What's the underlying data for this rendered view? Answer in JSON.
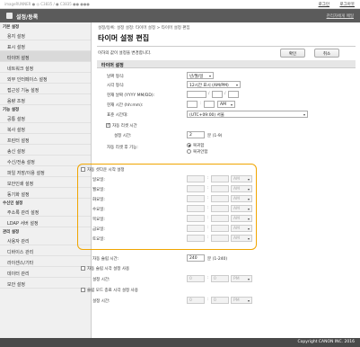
{
  "topbar": {
    "device": "imageRUNNER ● ◎ C3835 / ● C3835 ●● ●●●",
    "links": [
      "로그인",
      "로그아웃"
    ]
  },
  "titlebar": {
    "title": "설정/등록",
    "admin_link": "관리자에게 메일"
  },
  "sidebar": {
    "sections": [
      {
        "header": "기본 설정",
        "items": [
          "용지 설정",
          "표시 설정",
          "타이머 설정",
          "네트워크 설정",
          "외부 인터페이스 설정",
          "접근성 기능 설정",
          "음량 조정"
        ]
      },
      {
        "header": "기능 설정",
        "items": [
          "공통 설정",
          "복사 설정",
          "프린터 설정",
          "송신 설정",
          "수신/전송 설정",
          "파일 저장/이용 설정",
          "보안인쇄 설정",
          "동기화 설정"
        ]
      },
      {
        "header": "수신인 설정",
        "items": [
          "주소록 관리 설정",
          "LDAP 서버 설정"
        ]
      },
      {
        "header": "관리 설정",
        "items": [
          "사용자 관리",
          "디바이스 관리",
          "라이센스/기타",
          "데이터 관리",
          "보안 설정"
        ]
      }
    ],
    "active_item": "타이머 설정"
  },
  "content": {
    "breadcrumb": "설정/등록: 설정 설정: 타이머 설정 > 타이머 설정 편집",
    "title": "타이머 설정 편집",
    "intro": "이하의 값이 설정을 변경합니다.",
    "ok_label": "확인",
    "cancel_label": "취소",
    "section_title": "타이머 설정",
    "date_format_label": "날짜 형식:",
    "date_format_value": "년/월/일",
    "time_format_label": "시각 형식:",
    "time_format_value": "12시간 표시 (AM/PM)",
    "current_date_label": "현재 날짜 (YYYY MM/DD):",
    "current_date_sep": "/",
    "current_time_label": "현재 시간 (hh:mm):",
    "current_time_sep": ":",
    "current_time_ampm": "AM",
    "timezone_label": "표준 시간대:",
    "timezone_value": "(UTC+09:00) 서울",
    "auto_reset_label": "자동 리셋 시간",
    "set_time_label": "설정 시간:",
    "auto_reset_value": "2",
    "auto_reset_unit": "분 (1-9)",
    "after_reset_label": "자동 리셋 후 기능:",
    "after_reset_opt1": "복귀함",
    "after_reset_opt2": "복귀안함",
    "weekly_timer_label": "자동 셧다운 시작 설정",
    "weekdays": [
      "일요일:",
      "월요일:",
      "화요일:",
      "수요일:",
      "목요일:",
      "금요일:",
      "토요일:"
    ],
    "weekday_ampm": "AM",
    "auto_sleep_label": "자동 슬립 시간:",
    "auto_sleep_value": "240",
    "auto_sleep_unit": "분 (1-240)",
    "sleep_time_label": "자동 슬립 시각 설정 사용",
    "sleep_set_time_label": "설정 시간:",
    "sleep_h": "0",
    "sleep_m": "0",
    "sleep_ampm": "PM",
    "wake_time_label": "슬립 모드 종료 시각 설정 사용",
    "wake_set_time_label": "설정 시간:",
    "wake_h": "0",
    "wake_m": "0",
    "wake_ampm": "PM"
  },
  "footer": {
    "copyright": "Copyright CANON INC. 2016"
  },
  "colors": {
    "titlebar": "#5b5b5b",
    "highlight": "#f0a500",
    "footer": "#4a4a4a"
  }
}
